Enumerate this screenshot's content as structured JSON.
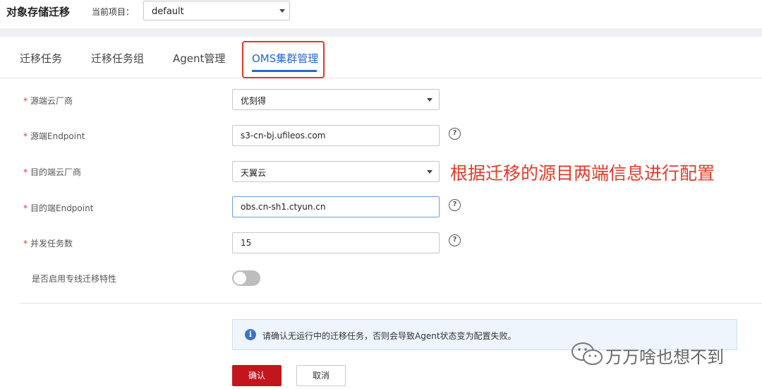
{
  "header": {
    "title": "对象存储迁移",
    "project_label": "当前项目：",
    "project_value": "default"
  },
  "tabs": [
    {
      "label": "迁移任务"
    },
    {
      "label": "迁移任务组"
    },
    {
      "label": "Agent管理"
    },
    {
      "label": "OMS集群管理"
    }
  ],
  "form": {
    "required_mark": "*",
    "source_vendor": {
      "label": "源端云厂商",
      "value": "优刻得"
    },
    "source_endpoint": {
      "label": "源端Endpoint",
      "value": "s3-cn-bj.ufileos.com"
    },
    "dest_vendor": {
      "label": "目的端云厂商",
      "value": "天翼云"
    },
    "dest_endpoint": {
      "label": "目的端Endpoint",
      "value": "obs.cn-sh1.ctyun.cn"
    },
    "concurrency": {
      "label": "并发任务数",
      "value": "15"
    },
    "dedicated_line": {
      "label": "是否启用专线迁移特性",
      "enabled": false
    },
    "help_glyph": "?"
  },
  "annotation": "根据迁移的源目两端信息进行配置",
  "info": {
    "icon": "i",
    "text": "请确认无运行中的迁移任务，否则会导致Agent状态变为配置失败。"
  },
  "buttons": {
    "confirm": "确认",
    "cancel": "取消"
  },
  "watermark": "万万啥也想不到",
  "colors": {
    "accent": "#2667d9",
    "primary_button": "#c4151c",
    "highlight_red": "#e4352b"
  }
}
